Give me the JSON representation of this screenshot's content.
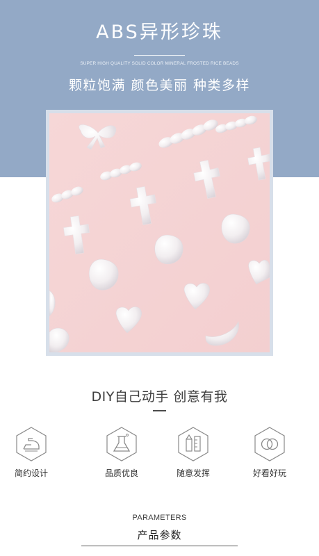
{
  "header": {
    "title": "ABS异形珍珠",
    "subtitle": "SUPER HIGH QUALITY SOLID COLOR MINERAL FROSTED RICE BEADS",
    "tagline": "颗粒饱满 颜色美丽 种类多样"
  },
  "slogan": "DIY自己动手 创意有我",
  "features": [
    {
      "label": "简约设计",
      "icon": "iron-icon"
    },
    {
      "label": "品质优良",
      "icon": "flask-icon"
    },
    {
      "label": "随意发挥",
      "icon": "design-tools-icon"
    },
    {
      "label": "好看好玩",
      "icon": "interlocking-rings-icon"
    }
  ],
  "parameters": {
    "title_en": "PARAMETERS",
    "title_cn": "产品参数"
  },
  "colors": {
    "banner": "#93a9c6",
    "photo_background": "#f7d6d6",
    "icon_stroke": "#8a8a8a"
  }
}
